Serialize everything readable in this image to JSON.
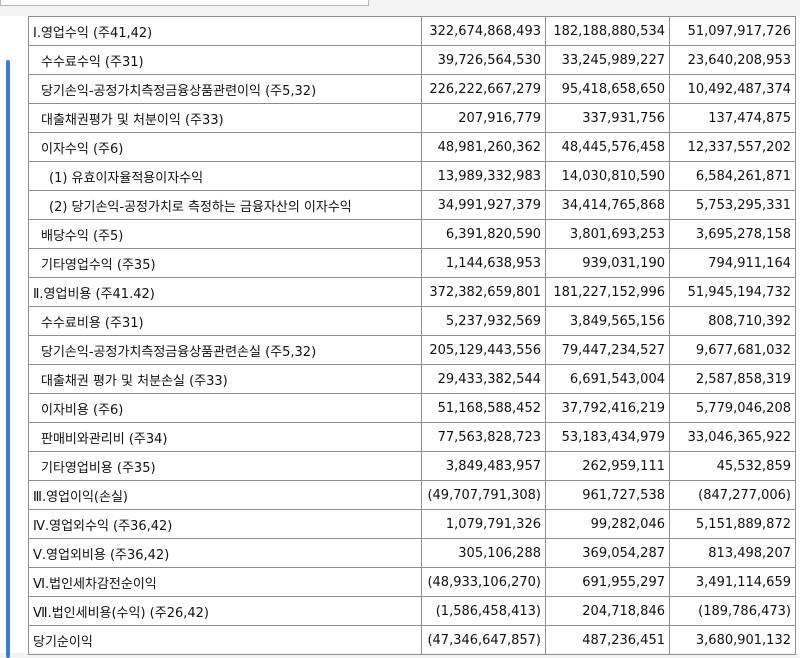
{
  "rows": [
    {
      "label": "Ⅰ.영업수익 (주41,42)",
      "indent": 0,
      "v1": "322,674,868,493",
      "v2": "182,188,880,534",
      "v3": "51,097,917,726"
    },
    {
      "label": "수수료수익 (주31)",
      "indent": 1,
      "v1": "39,726,564,530",
      "v2": "33,245,989,227",
      "v3": "23,640,208,953"
    },
    {
      "label": "당기손익-공정가치측정금융상품관련이익 (주5,32)",
      "indent": 1,
      "v1": "226,222,667,279",
      "v2": "95,418,658,650",
      "v3": "10,492,487,374"
    },
    {
      "label": "대출채권평가 및 처분이익 (주33)",
      "indent": 1,
      "v1": "207,916,779",
      "v2": "337,931,756",
      "v3": "137,474,875"
    },
    {
      "label": "이자수익 (주6)",
      "indent": 1,
      "v1": "48,981,260,362",
      "v2": "48,445,576,458",
      "v3": "12,337,557,202"
    },
    {
      "label": "(1) 유효이자율적용이자수익",
      "indent": 2,
      "v1": "13,989,332,983",
      "v2": "14,030,810,590",
      "v3": "6,584,261,871"
    },
    {
      "label": "(2) 당기손익-공정가치로 측정하는 금융자산의 이자수익",
      "indent": 2,
      "v1": "34,991,927,379",
      "v2": "34,414,765,868",
      "v3": "5,753,295,331"
    },
    {
      "label": "배당수익 (주5)",
      "indent": 1,
      "v1": "6,391,820,590",
      "v2": "3,801,693,253",
      "v3": "3,695,278,158"
    },
    {
      "label": "기타영업수익 (주35)",
      "indent": 1,
      "v1": "1,144,638,953",
      "v2": "939,031,190",
      "v3": "794,911,164"
    },
    {
      "label": "Ⅱ.영업비용 (주41.42)",
      "indent": 0,
      "v1": "372,382,659,801",
      "v2": "181,227,152,996",
      "v3": "51,945,194,732"
    },
    {
      "label": "수수료비용 (주31)",
      "indent": 1,
      "v1": "5,237,932,569",
      "v2": "3,849,565,156",
      "v3": "808,710,392"
    },
    {
      "label": "당기손익-공정가치측정금융상품관련손실 (주5,32)",
      "indent": 1,
      "v1": "205,129,443,556",
      "v2": "79,447,234,527",
      "v3": "9,677,681,032"
    },
    {
      "label": "대출채권 평가 및 처분손실 (주33)",
      "indent": 1,
      "v1": "29,433,382,544",
      "v2": "6,691,543,004",
      "v3": "2,587,858,319"
    },
    {
      "label": "이자비용 (주6)",
      "indent": 1,
      "v1": "51,168,588,452",
      "v2": "37,792,416,219",
      "v3": "5,779,046,208"
    },
    {
      "label": "판매비와관리비 (주34)",
      "indent": 1,
      "v1": "77,563,828,723",
      "v2": "53,183,434,979",
      "v3": "33,046,365,922"
    },
    {
      "label": "기타영업비용 (주35)",
      "indent": 1,
      "v1": "3,849,483,957",
      "v2": "262,959,111",
      "v3": "45,532,859"
    },
    {
      "label": "Ⅲ.영업이익(손실)",
      "indent": 0,
      "v1": "(49,707,791,308)",
      "v2": "961,727,538",
      "v3": "(847,277,006)"
    },
    {
      "label": "Ⅳ.영업외수익 (주36,42)",
      "indent": 0,
      "v1": "1,079,791,326",
      "v2": "99,282,046",
      "v3": "5,151,889,872"
    },
    {
      "label": "Ⅴ.영업외비용 (주36,42)",
      "indent": 0,
      "v1": "305,106,288",
      "v2": "369,054,287",
      "v3": "813,498,207"
    },
    {
      "label": "Ⅵ.법인세차감전순이익",
      "indent": 0,
      "v1": "(48,933,106,270)",
      "v2": "691,955,297",
      "v3": "3,491,114,659"
    },
    {
      "label": "Ⅶ.법인세비용(수익) (주26,42)",
      "indent": 0,
      "v1": "(1,586,458,413)",
      "v2": "204,718,846",
      "v3": "(189,786,473)"
    },
    {
      "label": "당기순이익",
      "indent": 0,
      "v1": "(47,346,647,857)",
      "v2": "487,236,451",
      "v3": "3,680,901,132"
    }
  ]
}
